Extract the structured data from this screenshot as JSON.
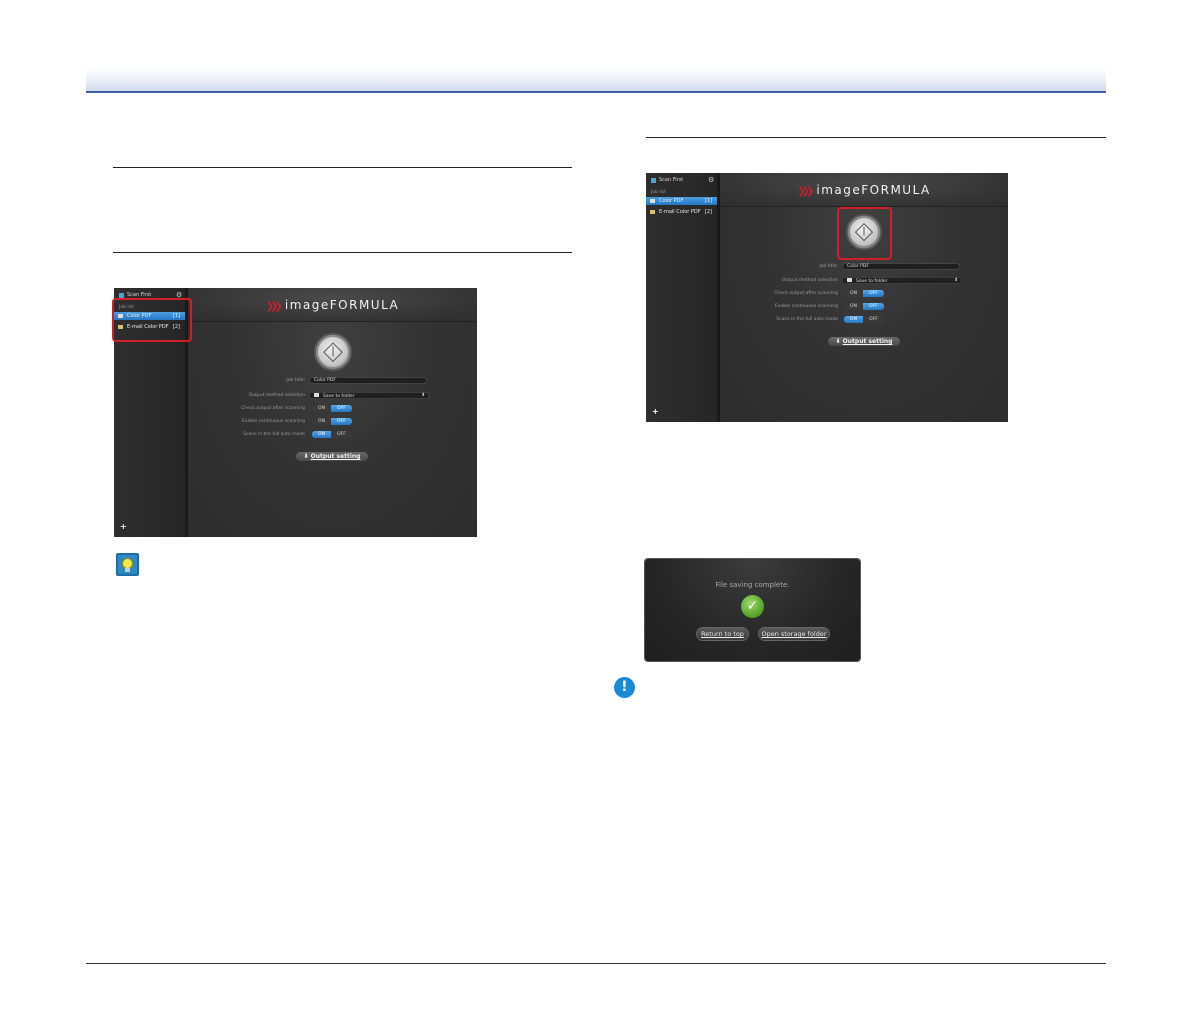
{
  "screenshot_left": {
    "sidebar": {
      "scan_first": "Scan First",
      "job_list_label": "Job list",
      "jobs": [
        {
          "name": "Color PDF",
          "number": "[1]",
          "selected": true
        },
        {
          "name": "E-mail Color PDF",
          "number": "[2]",
          "selected": false
        }
      ]
    },
    "logo": "imageFORMULA",
    "settings": {
      "job_title_label": "Job title:",
      "job_title_value": "Color PDF",
      "output_method_label": "Output method selection",
      "output_method_value": "Save to folder",
      "check_output_label": "Check output after scanning",
      "continuous_label": "Enable continuous scanning",
      "full_auto_label": "Scans in the full auto mode",
      "on": "ON",
      "off": "OFF"
    },
    "output_setting_button": "Output setting"
  },
  "screenshot_right": {
    "sidebar": {
      "scan_first": "Scan First",
      "job_list_label": "Job list",
      "jobs": [
        {
          "name": "Color PDF",
          "number": "[1]",
          "selected": true
        },
        {
          "name": "E-mail Color PDF",
          "number": "[2]",
          "selected": false
        }
      ]
    },
    "logo": "imageFORMULA",
    "settings": {
      "job_title_label": "Job title:",
      "job_title_value": "Color PDF",
      "output_method_label": "Output method selection",
      "output_method_value": "Save to folder",
      "check_output_label": "Check output after scanning",
      "continuous_label": "Enable continuous scanning",
      "full_auto_label": "Scans in the full auto mode",
      "on": "ON",
      "off": "OFF"
    },
    "output_setting_button": "Output setting"
  },
  "dialog": {
    "message": "File saving complete.",
    "return_button": "Return to top",
    "open_button": "Open storage folder"
  },
  "colors": {
    "header_line": "#3f5fa8",
    "highlight_red": "#d21e2b",
    "selected_blue": "#2f86d6",
    "logo_chevron": "#c8202a"
  },
  "icons": [
    "hint-lightbulb-icon",
    "important-exclamation-icon"
  ]
}
